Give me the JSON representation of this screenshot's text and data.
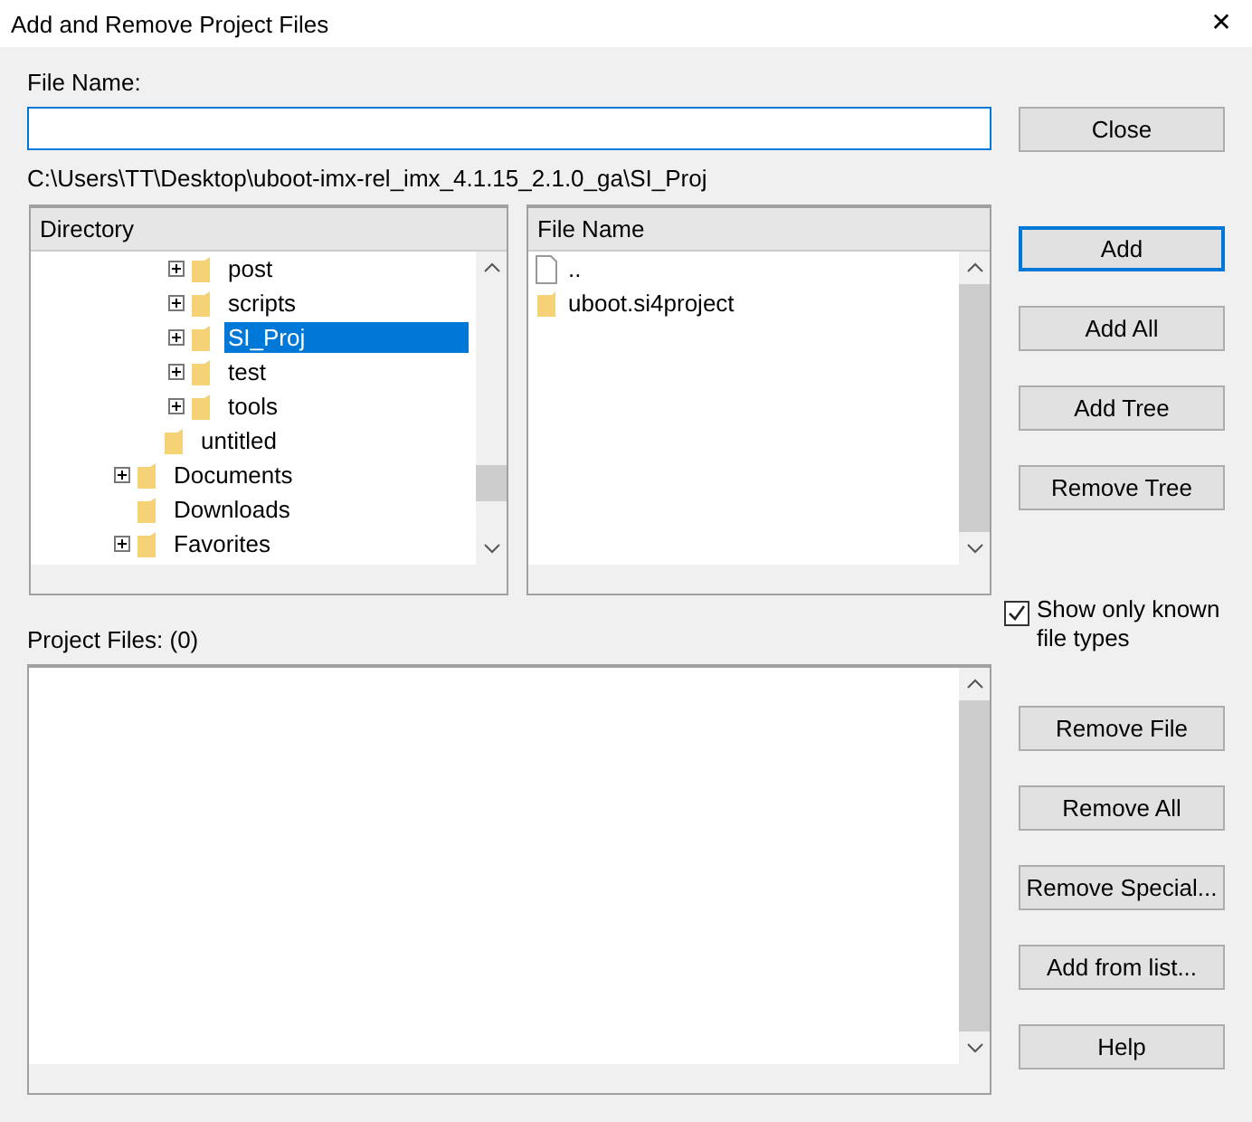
{
  "window": {
    "title": "Add and Remove Project Files",
    "close": "✕"
  },
  "file_name": {
    "label": "File Name:"
  },
  "path": "C:\\Users\\TT\\Desktop\\uboot-imx-rel_imx_4.1.15_2.1.0_ga\\SI_Proj",
  "directory": {
    "header": "Directory",
    "items": [
      {
        "children": [
          {
            "children": [
              {
                "label": "post",
                "expandable": true,
                "selected": false
              },
              {
                "label": "scripts",
                "expandable": true,
                "selected": false
              },
              {
                "label": "SI_Proj",
                "expandable": true,
                "selected": true
              },
              {
                "label": "test",
                "expandable": true,
                "selected": false
              },
              {
                "label": "tools",
                "expandable": true,
                "selected": false
              }
            ]
          },
          {
            "label": "untitled",
            "expandable": false,
            "selected": false
          }
        ]
      },
      {
        "label": "Documents",
        "expandable": true,
        "selected": false
      },
      {
        "label": "Downloads",
        "expandable": false,
        "selected": false
      },
      {
        "label": "Favorites",
        "expandable": true,
        "selected": false
      }
    ]
  },
  "files": {
    "header": "File Name",
    "items": [
      {
        "label": "..",
        "kind": "file"
      },
      {
        "label": "uboot.si4project",
        "kind": "folder"
      }
    ]
  },
  "project_files": {
    "label": "Project Files: (0)"
  },
  "buttons_top": [
    {
      "label": "Close",
      "default": false
    },
    {
      "label": "Add",
      "default": true
    },
    {
      "label": "Add All",
      "default": false
    },
    {
      "label": "Add Tree",
      "default": false
    },
    {
      "label": "Remove Tree",
      "default": false
    }
  ],
  "show_known": {
    "label": "Show only known file types",
    "checked": true
  },
  "buttons_bottom": [
    {
      "label": "Remove File"
    },
    {
      "label": "Remove All"
    },
    {
      "label": "Remove Special..."
    },
    {
      "label": "Add from list..."
    },
    {
      "label": "Help"
    }
  ]
}
